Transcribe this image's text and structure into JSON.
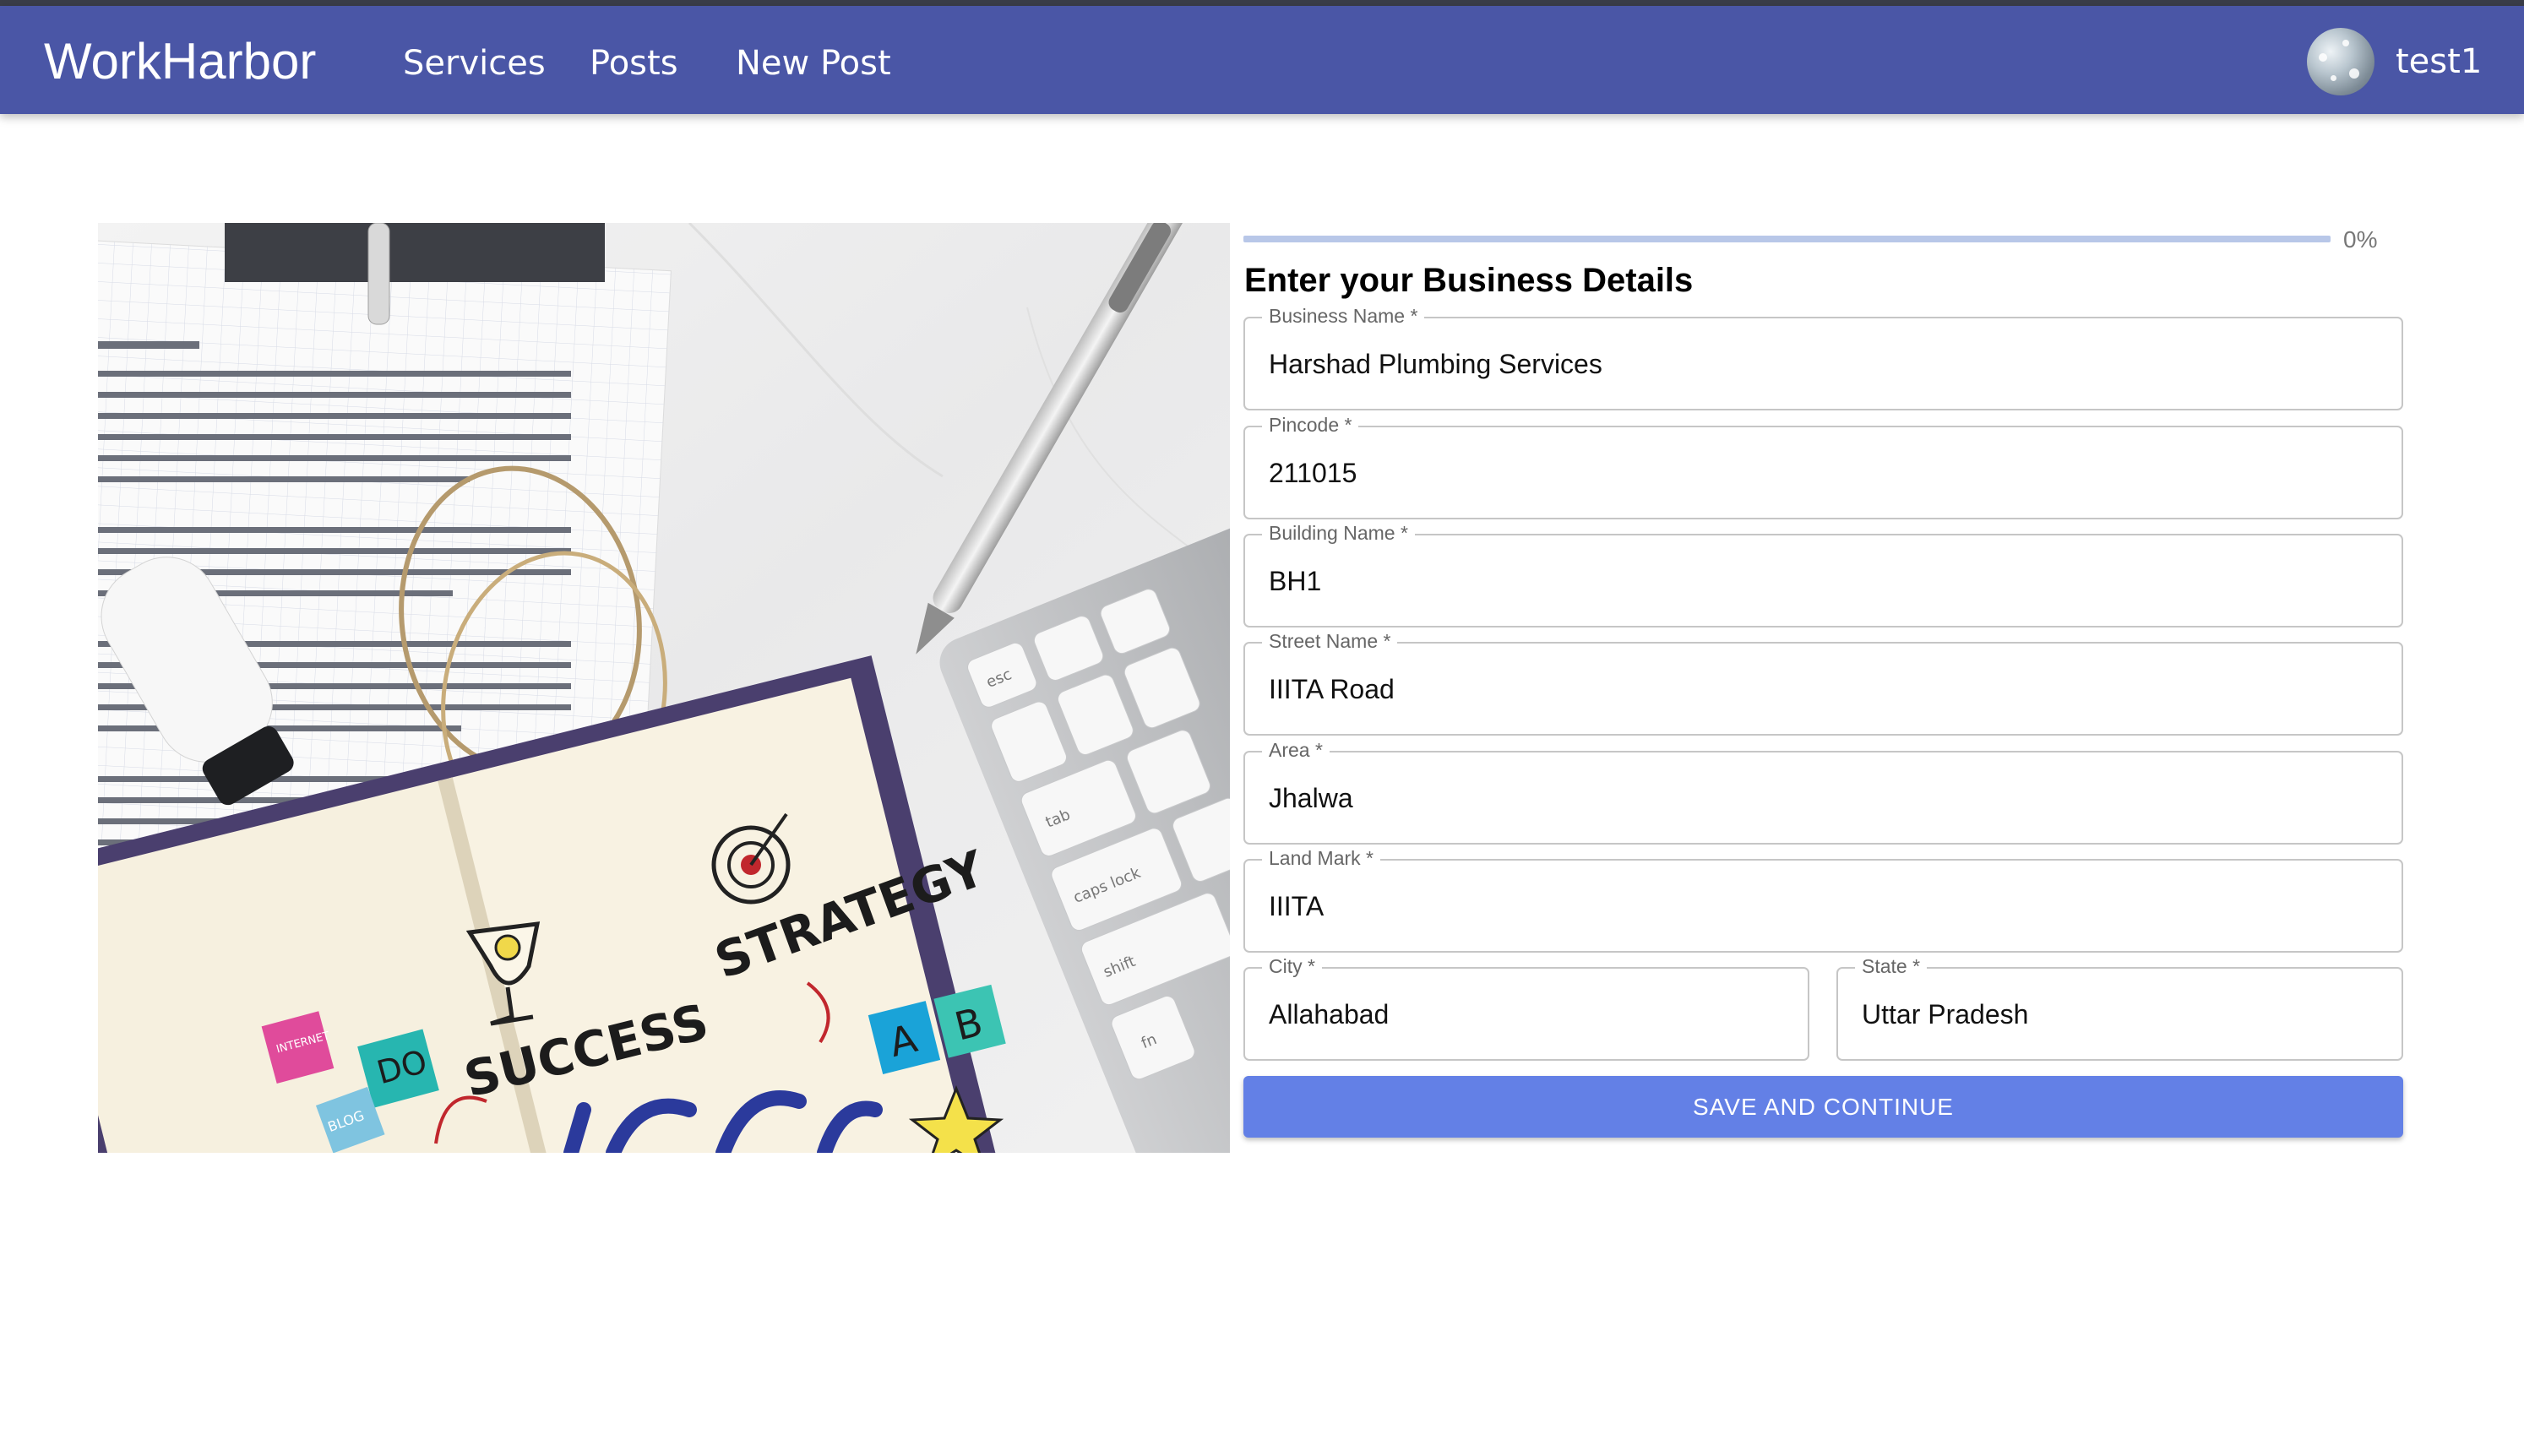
{
  "app": {
    "brand": "WorkHarbor"
  },
  "nav": {
    "items": [
      {
        "label": "Services"
      },
      {
        "label": "Posts"
      },
      {
        "label": "New Post"
      }
    ]
  },
  "user": {
    "name": "test1"
  },
  "hero": {
    "notebook_words": [
      "SUCCESS",
      "STRATEGY"
    ],
    "stickies": [
      "INTERNET",
      "DO",
      "BLOG"
    ],
    "ab_letters": [
      "A",
      "B"
    ],
    "keyboard_keys": [
      "esc",
      "tab",
      "caps lock",
      "shift",
      "fn"
    ]
  },
  "progress": {
    "value": 0,
    "label": "0%"
  },
  "form": {
    "title": "Enter your Business Details",
    "fields": {
      "business_name": {
        "label": "Business Name *",
        "value": "Harshad Plumbing Services"
      },
      "pincode": {
        "label": "Pincode *",
        "value": "211015"
      },
      "building_name": {
        "label": "Building Name *",
        "value": "BH1"
      },
      "street_name": {
        "label": "Street Name *",
        "value": "IIITA Road"
      },
      "area": {
        "label": "Area *",
        "value": "Jhalwa"
      },
      "land_mark": {
        "label": "Land Mark *",
        "value": "IIITA"
      },
      "city": {
        "label": "City *",
        "value": "Allahabad"
      },
      "state": {
        "label": "State *",
        "value": "Uttar Pradesh"
      }
    },
    "submit_label": "SAVE AND CONTINUE"
  },
  "colors": {
    "navbar": "#4a56a6",
    "button": "#6380e6",
    "progress_track": "#b8c7e8"
  }
}
